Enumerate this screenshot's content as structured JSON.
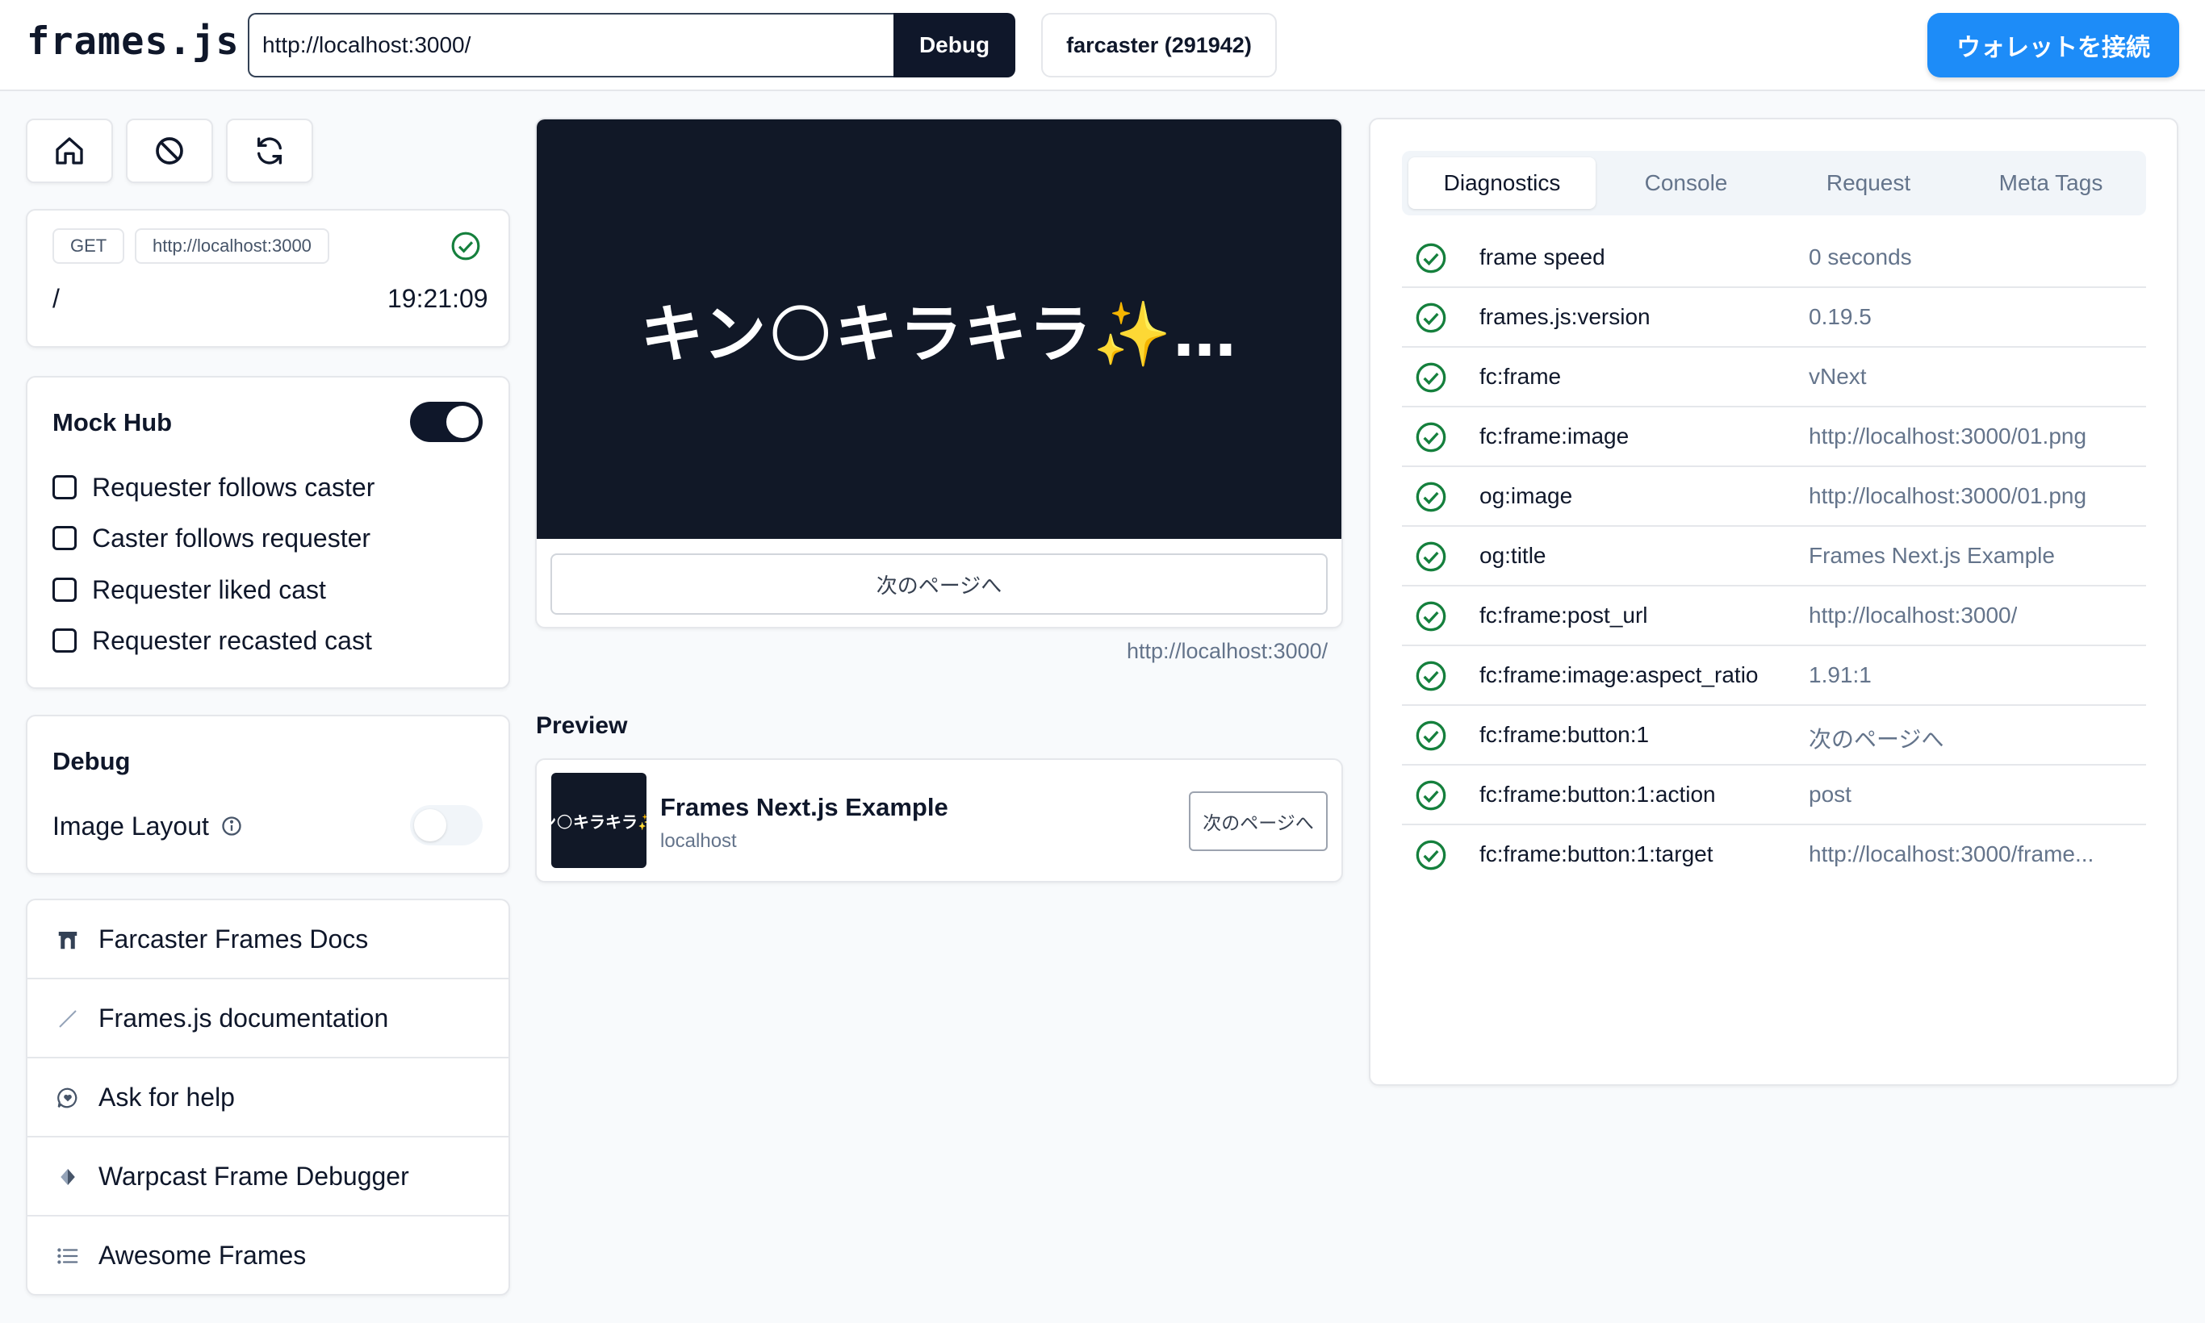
{
  "header": {
    "logo": "frames.js",
    "url_value": "http://localhost:3000/",
    "debug_label": "Debug",
    "farcaster_label": "farcaster (291942)",
    "wallet_label": "ウォレットを接続"
  },
  "request": {
    "method": "GET",
    "url": "http://localhost:3000",
    "path": "/",
    "time": "19:21:09"
  },
  "mock_hub": {
    "title": "Mock Hub",
    "enabled": true,
    "options": [
      "Requester follows caster",
      "Caster follows requester",
      "Requester liked cast",
      "Requester recasted cast"
    ]
  },
  "debug_panel": {
    "title": "Debug",
    "image_layout_label": "Image Layout",
    "image_layout_enabled": false
  },
  "links": [
    {
      "label": "Farcaster Frames Docs",
      "icon": "arch-icon"
    },
    {
      "label": "Frames.js documentation",
      "icon": "arrow-up-right-icon"
    },
    {
      "label": "Ask for help",
      "icon": "chat-heart-icon"
    },
    {
      "label": "Warpcast Frame Debugger",
      "icon": "diamond-icon"
    },
    {
      "label": "Awesome Frames",
      "icon": "list-icon"
    }
  ],
  "frame": {
    "image_text": "キン🌕キラキラ✨…",
    "button_label": "次のページへ",
    "url": "http://localhost:3000/"
  },
  "preview": {
    "heading": "Preview",
    "thumb_text": "ン🌕キラキラ✨",
    "title": "Frames Next.js Example",
    "domain": "localhost",
    "button_label": "次のページへ"
  },
  "diagnostics": {
    "tabs": [
      "Diagnostics",
      "Console",
      "Request",
      "Meta Tags"
    ],
    "rows": [
      {
        "key": "frame speed",
        "value": "0 seconds"
      },
      {
        "key": "frames.js:version",
        "value": "0.19.5"
      },
      {
        "key": "fc:frame",
        "value": "vNext"
      },
      {
        "key": "fc:frame:image",
        "value": "http://localhost:3000/01.png"
      },
      {
        "key": "og:image",
        "value": "http://localhost:3000/01.png"
      },
      {
        "key": "og:title",
        "value": "Frames Next.js Example"
      },
      {
        "key": "fc:frame:post_url",
        "value": "http://localhost:3000/"
      },
      {
        "key": "fc:frame:image:aspect_ratio",
        "value": "1.91:1"
      },
      {
        "key": "fc:frame:button:1",
        "value": "次のページへ"
      },
      {
        "key": "fc:frame:button:1:action",
        "value": "post"
      },
      {
        "key": "fc:frame:button:1:target",
        "value": "http://localhost:3000/frame..."
      }
    ]
  },
  "colors": {
    "primary": "#0f172a",
    "accent": "#1d8cf8",
    "success": "#15803d",
    "muted": "#64748b",
    "border": "#e5e7eb"
  }
}
